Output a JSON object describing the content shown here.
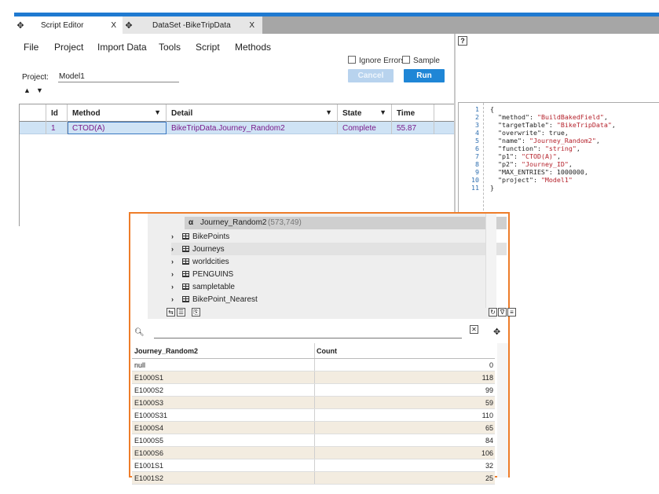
{
  "tabs": [
    {
      "label": "Script Editor",
      "close": "X"
    },
    {
      "label": "DataSet -BikeTripData",
      "close": "X"
    }
  ],
  "menu": [
    "File",
    "Project",
    "Import Data",
    "Tools",
    "Script",
    "Methods"
  ],
  "options": {
    "ignore_errors": "Ignore Errors",
    "sample": "Sample"
  },
  "project": {
    "label": "Project:",
    "value": "Model1"
  },
  "buttons": {
    "cancel": "Cancel",
    "run": "Run"
  },
  "grid": {
    "columns": [
      "Id",
      "Method",
      "Detail",
      "State",
      "Time"
    ],
    "rows": [
      {
        "id": "1",
        "method": "CTOD(A)",
        "detail": "BikeTripData.Journey_Random2",
        "state": "Complete",
        "time": "55.87"
      }
    ]
  },
  "help_icon": "?",
  "code": {
    "line_numbers": [
      "1",
      "2",
      "3",
      "4",
      "5",
      "6",
      "7",
      "8",
      "9",
      "10",
      "11"
    ],
    "lines": [
      [
        {
          "t": "k",
          "v": "{"
        }
      ],
      [
        {
          "t": "k",
          "v": "  \"method\": "
        },
        {
          "t": "s",
          "v": "\"BuildBakedField\""
        },
        {
          "t": "k",
          "v": ","
        }
      ],
      [
        {
          "t": "k",
          "v": "  \"targetTable\": "
        },
        {
          "t": "s",
          "v": "\"BikeTripData\""
        },
        {
          "t": "k",
          "v": ","
        }
      ],
      [
        {
          "t": "k",
          "v": "  \"overwrite\": true,"
        }
      ],
      [
        {
          "t": "k",
          "v": "  \"name\": "
        },
        {
          "t": "s",
          "v": "\"Journey_Random2\""
        },
        {
          "t": "k",
          "v": ","
        }
      ],
      [
        {
          "t": "k",
          "v": "  \"function\": "
        },
        {
          "t": "s",
          "v": "\"string\""
        },
        {
          "t": "k",
          "v": ","
        }
      ],
      [
        {
          "t": "k",
          "v": "  \"p1\": "
        },
        {
          "t": "s",
          "v": "\"CTOD(A)\""
        },
        {
          "t": "k",
          "v": ","
        }
      ],
      [
        {
          "t": "k",
          "v": "  \"p2\": "
        },
        {
          "t": "s",
          "v": "\"Journey_ID\""
        },
        {
          "t": "k",
          "v": ","
        }
      ],
      [
        {
          "t": "k",
          "v": "  \"MAX_ENTRIES\": 1000000,"
        }
      ],
      [
        {
          "t": "k",
          "v": "  \"project\": "
        },
        {
          "t": "s",
          "v": "\"Model1\""
        }
      ],
      [
        {
          "t": "k",
          "v": "}"
        }
      ]
    ]
  },
  "tree": {
    "selected": {
      "alpha": "α",
      "name": "Journey_Random2",
      "count": "(573,749)"
    },
    "items": [
      {
        "name": "BikePoints",
        "highlight": false
      },
      {
        "name": "Journeys",
        "highlight": true
      },
      {
        "name": "worldcities",
        "highlight": false
      },
      {
        "name": "PENGUINS",
        "highlight": false
      },
      {
        "name": "sampletable",
        "highlight": false
      },
      {
        "name": "BikePoint_Nearest",
        "highlight": false
      }
    ]
  },
  "values_table": {
    "columns": [
      "Journey_Random2",
      "Count"
    ],
    "rows": [
      [
        "null",
        "0"
      ],
      [
        "E1000S1",
        "118"
      ],
      [
        "E1000S2",
        "99"
      ],
      [
        "E1000S3",
        "59"
      ],
      [
        "E1000S31",
        "110"
      ],
      [
        "E1000S4",
        "65"
      ],
      [
        "E1000S5",
        "84"
      ],
      [
        "E1000S6",
        "106"
      ],
      [
        "E1001S1",
        "32"
      ],
      [
        "E1001S2",
        "25"
      ]
    ]
  },
  "colors": {
    "accent": "#1f86d6",
    "popup_border": "#ee7d2a",
    "selected_row": "#cfe3f5",
    "alt_row": "#f3ece0"
  }
}
